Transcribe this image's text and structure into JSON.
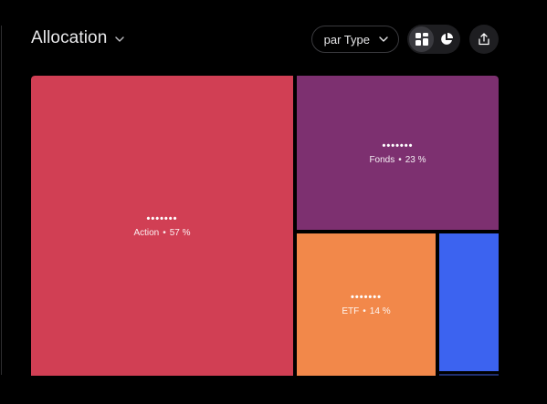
{
  "header": {
    "title": "Allocation",
    "group_by_label": "par Type"
  },
  "icons": {
    "title_chevron": "chevron-down-icon",
    "dropdown_chevron": "chevron-down-icon",
    "treemap_view": "grid-icon",
    "pie_view": "pie-chart-icon",
    "share": "share-icon"
  },
  "view_toggle": {
    "selected": "treemap"
  },
  "allocation": {
    "items": [
      {
        "name": "Action",
        "masked_value": "•••••••",
        "percent_label": "57 %",
        "percent": 57,
        "color": "#d13f54"
      },
      {
        "name": "Fonds",
        "masked_value": "•••••••",
        "percent_label": "23 %",
        "percent": 23,
        "color": "#7d3070"
      },
      {
        "name": "ETF",
        "masked_value": "•••••••",
        "percent_label": "14 %",
        "percent": 14,
        "color": "#f2884a"
      },
      {
        "name": "",
        "masked_value": "",
        "percent_label": "",
        "color": "#3c63f0"
      },
      {
        "name": "",
        "masked_value": "",
        "percent_label": "",
        "color": "#1f2e6e"
      }
    ],
    "separator": "•"
  }
}
